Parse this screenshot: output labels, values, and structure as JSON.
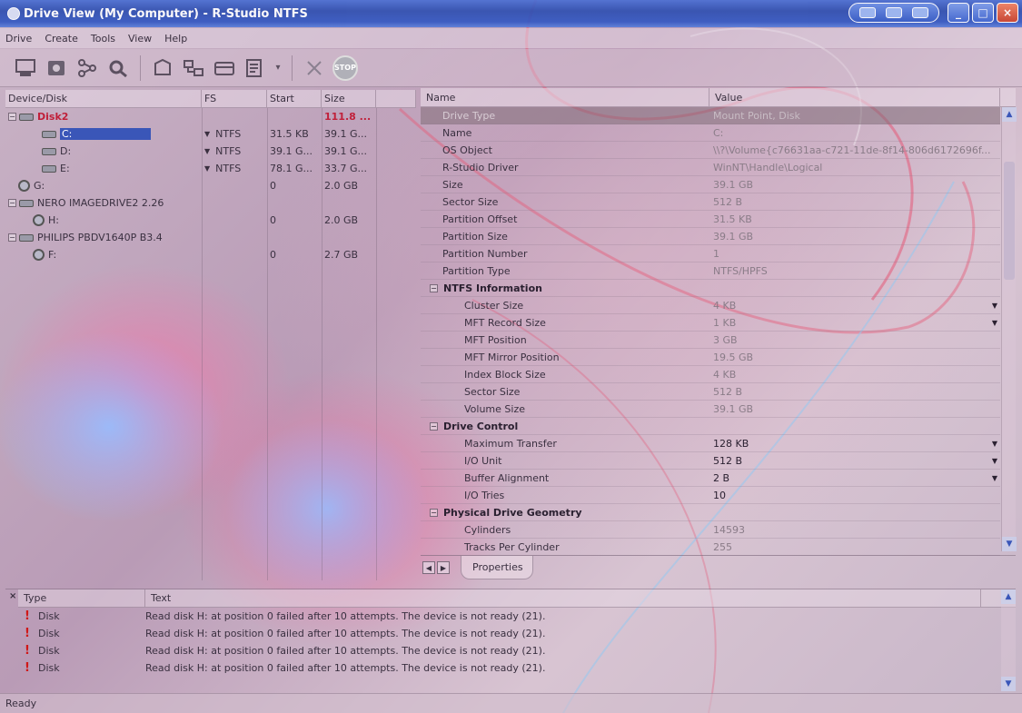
{
  "window": {
    "title": "Drive View (My Computer) - R-Studio NTFS"
  },
  "menu": [
    "Drive",
    "Create",
    "Tools",
    "View",
    "Help"
  ],
  "toolbar": {
    "icons": [
      "drive-icon",
      "scan-icon",
      "tree-icon",
      "find-icon",
      "open-drive-icon",
      "network-icon",
      "region-icon",
      "image-icon",
      "delete-icon",
      "stop-icon"
    ],
    "stop_label": "STOP"
  },
  "left": {
    "headers": {
      "device": "Device/Disk",
      "fs": "FS",
      "start": "Start",
      "size": "Size"
    },
    "rows": [
      {
        "name": "Disk2",
        "fs": "",
        "start": "",
        "size": "111.8 ..."
      },
      {
        "name": "C:",
        "fs": "NTFS",
        "start": "31.5 KB",
        "size": "39.1 G..."
      },
      {
        "name": "D:",
        "fs": "NTFS",
        "start": "39.1 G...",
        "size": "39.1 G..."
      },
      {
        "name": "E:",
        "fs": "NTFS",
        "start": "78.1 G...",
        "size": "33.7 G..."
      },
      {
        "name": "G:",
        "fs": "",
        "start": "0",
        "size": "2.0 GB"
      },
      {
        "name": "NERO IMAGEDRIVE2 2.26",
        "fs": "",
        "start": "",
        "size": ""
      },
      {
        "name": "H:",
        "fs": "",
        "start": "0",
        "size": "2.0 GB"
      },
      {
        "name": "PHILIPS PBDV1640P B3.4",
        "fs": "",
        "start": "",
        "size": ""
      },
      {
        "name": "F:",
        "fs": "",
        "start": "0",
        "size": "2.7 GB"
      }
    ]
  },
  "props": {
    "headers": {
      "name": "Name",
      "value": "Value"
    },
    "rows": [
      {
        "name": "Drive Type",
        "value": "Mount Point, Disk"
      },
      {
        "name": "Name",
        "value": "C:"
      },
      {
        "name": "OS Object",
        "value": "\\\\?\\Volume{c76631aa-c721-11de-8f14-806d6172696f..."
      },
      {
        "name": "R-Studio Driver",
        "value": "WinNT\\Handle\\Logical"
      },
      {
        "name": "Size",
        "value": "39.1 GB"
      },
      {
        "name": "Sector Size",
        "value": "512 B"
      },
      {
        "name": "Partition Offset",
        "value": "31.5 KB"
      },
      {
        "name": "Partition Size",
        "value": "39.1 GB"
      },
      {
        "name": "Partition Number",
        "value": "1"
      },
      {
        "name": "Partition Type",
        "value": "NTFS/HPFS"
      },
      {
        "name": "NTFS Information",
        "value": ""
      },
      {
        "name": "Cluster Size",
        "value": "4 KB"
      },
      {
        "name": "MFT Record Size",
        "value": "1 KB"
      },
      {
        "name": "MFT Position",
        "value": "3 GB"
      },
      {
        "name": "MFT Mirror Position",
        "value": "19.5 GB"
      },
      {
        "name": "Index Block Size",
        "value": "4 KB"
      },
      {
        "name": "Sector Size",
        "value": "512 B"
      },
      {
        "name": "Volume Size",
        "value": "39.1 GB"
      },
      {
        "name": "Drive Control",
        "value": ""
      },
      {
        "name": "Maximum Transfer",
        "value": "128 KB"
      },
      {
        "name": "I/O Unit",
        "value": "512 B"
      },
      {
        "name": "Buffer Alignment",
        "value": "2 B"
      },
      {
        "name": "I/O Tries",
        "value": "10"
      },
      {
        "name": "Physical Drive Geometry",
        "value": ""
      },
      {
        "name": "Cylinders",
        "value": "14593"
      },
      {
        "name": "Tracks Per Cylinder",
        "value": "255"
      }
    ]
  },
  "tabs": {
    "properties": "Properties"
  },
  "log": {
    "close": "×",
    "headers": {
      "type": "Type",
      "text": "Text"
    },
    "rows": [
      {
        "type": "Disk",
        "text": "Read disk H: at position 0 failed after 10 attempts. The device is not ready (21)."
      },
      {
        "type": "Disk",
        "text": "Read disk H: at position 0 failed after 10 attempts. The device is not ready (21)."
      },
      {
        "type": "Disk",
        "text": "Read disk H: at position 0 failed after 10 attempts. The device is not ready (21)."
      },
      {
        "type": "Disk",
        "text": "Read disk H: at position 0 failed after 10 attempts. The device is not ready (21)."
      }
    ]
  },
  "status": {
    "text": "Ready"
  },
  "colors": {
    "titlebar": "#2f4fb0",
    "selection": "#3a56b8",
    "disk_red": "#c0203a",
    "warning": "#d01818"
  }
}
